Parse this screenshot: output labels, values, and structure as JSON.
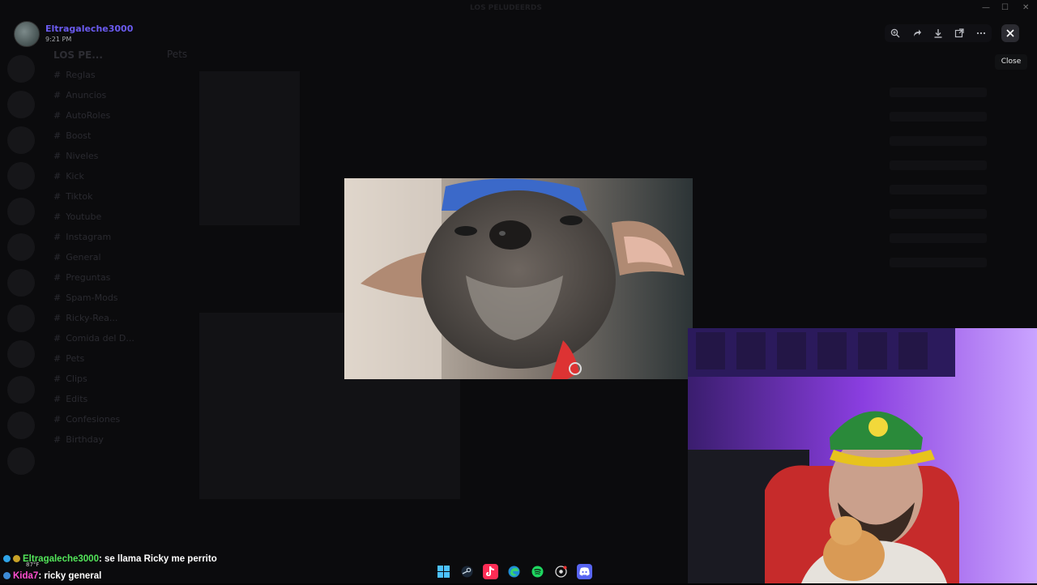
{
  "window": {
    "title": "LOS PELUDEERDS"
  },
  "uploader": {
    "name": "Eltragaleche3000",
    "time": "9:21 PM"
  },
  "toolbar": {
    "icons": [
      "zoom-icon",
      "forward-icon",
      "download-icon",
      "open-external-icon",
      "more-icon"
    ],
    "close_tooltip": "Close"
  },
  "background": {
    "server_name": "LOS PE...",
    "channel_header": "Pets",
    "channels": [
      "Reglas",
      "Anuncios",
      "AutoRoles",
      "Boost",
      "Niveles",
      "Kick",
      "Tiktok",
      "Youtube",
      "Instagram",
      "General",
      "Preguntas",
      "Spam-Mods",
      "Ricky-Rea...",
      "Comida del D...",
      "Pets",
      "Clips",
      "Edits",
      "Confesiones",
      "Birthday"
    ]
  },
  "stream_chat": [
    {
      "user": "Eltragaleche3000",
      "message": ": se llama Ricky me perrito",
      "color": "#53e65a"
    },
    {
      "user": "Kida7",
      "message": ": ricky general",
      "color": "#ff4fd0"
    }
  ],
  "taskbar": {
    "icons": [
      "windows-start-icon",
      "steam-icon",
      "tiktok-icon",
      "edge-icon",
      "spotify-icon",
      "chrome-icon",
      "discord-icon"
    ],
    "weather": "87°F"
  },
  "colors": {
    "accent": "#6b5bf0",
    "background": "#050506"
  }
}
